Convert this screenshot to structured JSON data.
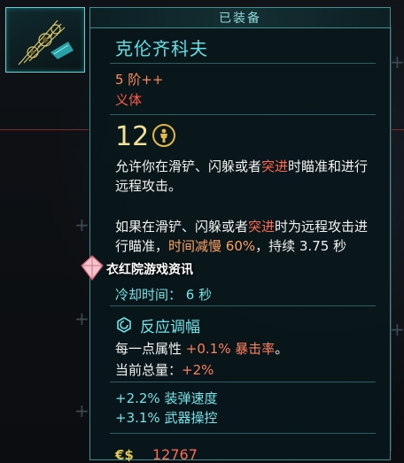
{
  "tooltip": {
    "equipped_tab": "已装备",
    "title": "克伦齐科夫",
    "tier": "5 阶++",
    "category": "义体",
    "capacity_cost": "12",
    "description1_parts": [
      "允许你在滑铲、闪躲或者",
      "突进",
      "时瞄准和进行远程攻击。"
    ],
    "description2_parts": [
      "如果在滑铲、闪躲或者",
      "突进",
      "时为远程攻击进行瞄准，",
      "时间减慢 60%",
      "，持续 3.75 秒"
    ],
    "cooldown": "冷却时间： 6 秒",
    "perk": {
      "name": "反应调幅",
      "line1_prefix": "每一点属性 ",
      "line1_value": "+0.1% 暴击率",
      "line1_suffix": "。",
      "line2_prefix": "当前总量：",
      "line2_value": "+2%"
    },
    "stats": [
      "+2.2% 装弹速度",
      "+3.1% 武器操控"
    ],
    "price_symbol": "€$",
    "price": "12767"
  },
  "watermark": {
    "text": "衣红院游戏资讯"
  },
  "colors": {
    "accent_cyan": "#5fe1e6",
    "highlight_red": "#ff6a4e",
    "tier_orange": "#ff8a5c",
    "cost_yellow": "#f1e29a"
  },
  "icons": {
    "slot": "kerenzikov-cyberware-icon",
    "capacity": "cyberware-capacity-icon",
    "perk": "perk-ring-icon",
    "currency": "eurodollar-icon"
  }
}
